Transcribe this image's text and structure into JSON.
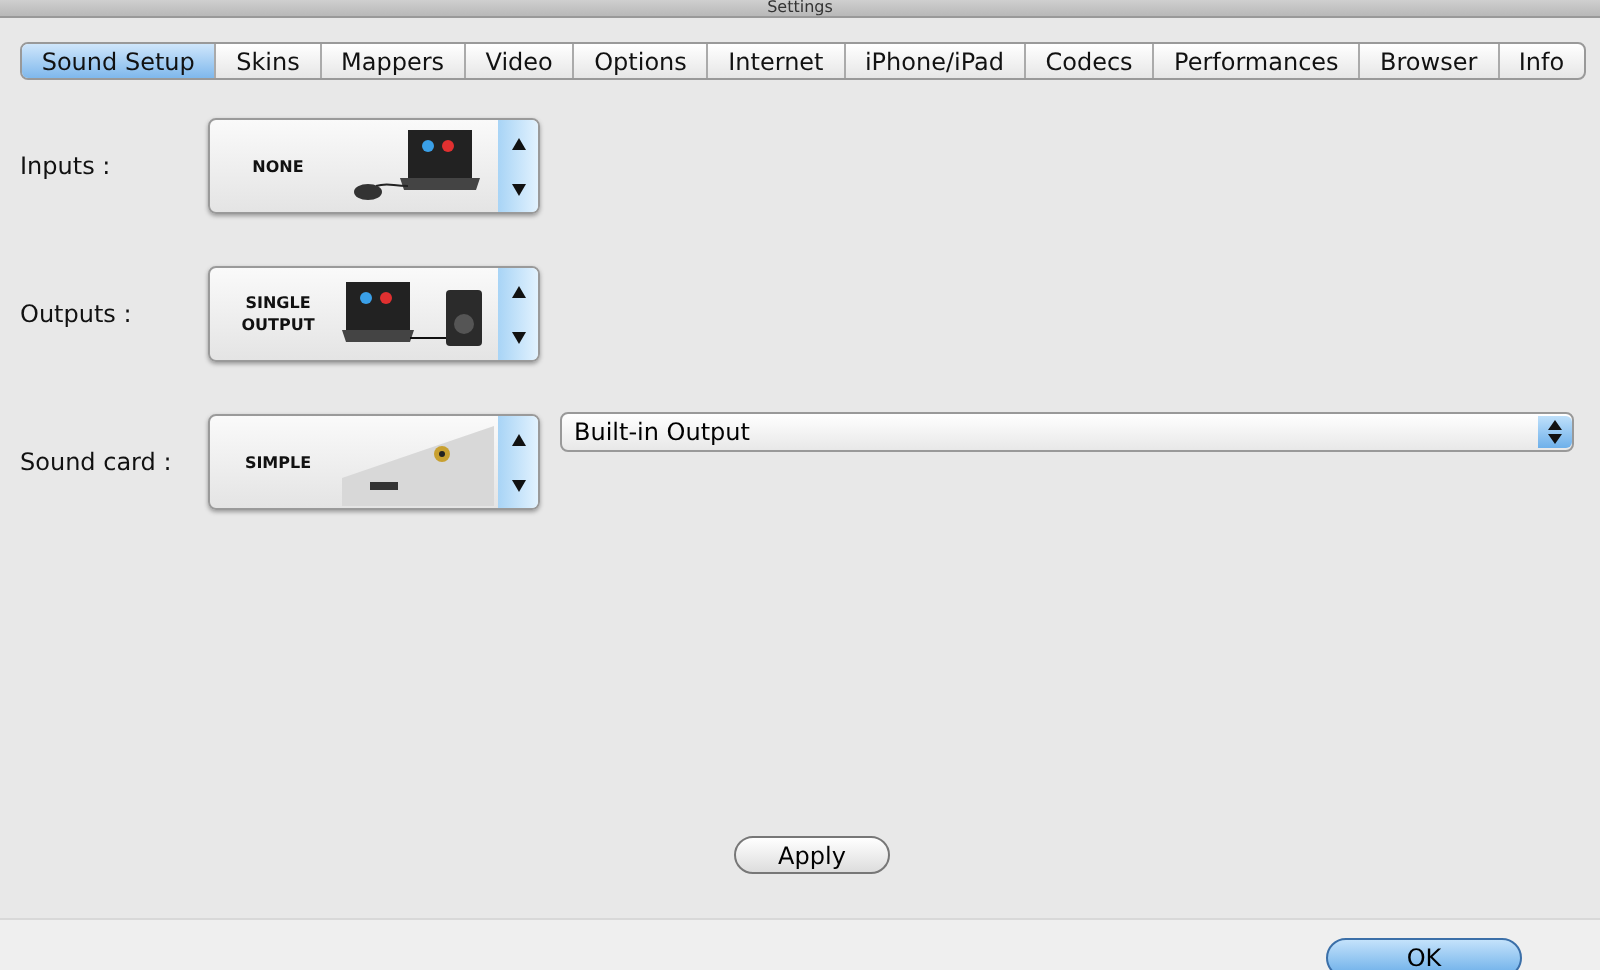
{
  "window": {
    "title": "Settings"
  },
  "tabs": [
    {
      "label": "Sound Setup",
      "selected": true
    },
    {
      "label": "Skins",
      "selected": false
    },
    {
      "label": "Mappers",
      "selected": false
    },
    {
      "label": "Video",
      "selected": false
    },
    {
      "label": "Options",
      "selected": false
    },
    {
      "label": "Internet",
      "selected": false
    },
    {
      "label": "iPhone/iPad",
      "selected": false
    },
    {
      "label": "Codecs",
      "selected": false
    },
    {
      "label": "Performances",
      "selected": false
    },
    {
      "label": "Browser",
      "selected": false
    },
    {
      "label": "Info",
      "selected": false
    }
  ],
  "rows": [
    {
      "label": "Inputs :",
      "picker": {
        "value": "NONE",
        "kind": "laptop-mouse"
      }
    },
    {
      "label": "Outputs :",
      "picker": {
        "value": "SINGLE OUTPUT",
        "kind": "laptop-speaker"
      }
    },
    {
      "label": "Sound card :",
      "picker": {
        "value": "SIMPLE",
        "kind": "jack-port"
      },
      "dropdown": {
        "value": "Built-in Output"
      }
    }
  ],
  "apply_button": "Apply",
  "ok_button": "OK"
}
